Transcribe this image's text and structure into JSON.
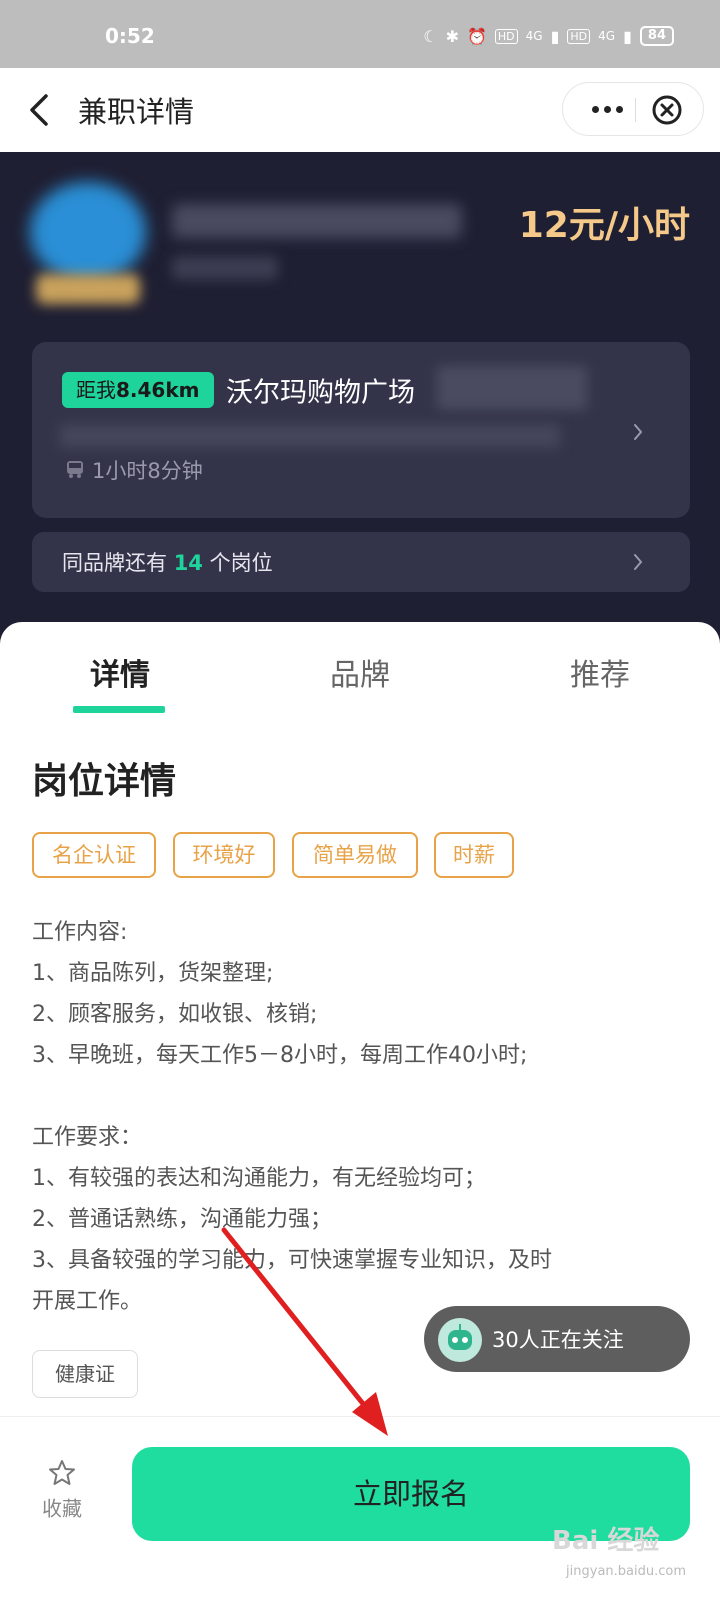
{
  "status_bar": {
    "time": "0:52",
    "battery": "84",
    "network_1": "4G",
    "network_2": "4G",
    "hd_1": "HD",
    "hd_2": "HD"
  },
  "nav": {
    "title": "兼职详情"
  },
  "job": {
    "salary": "12元/小时"
  },
  "location": {
    "distance_prefix": "距我",
    "distance_value": "8.46km",
    "place_name": "沃尔玛购物广场",
    "transit_time": "1小时8分钟"
  },
  "brand_bar": {
    "prefix": "同品牌还有 ",
    "count": "14",
    "suffix": " 个岗位"
  },
  "tabs": [
    {
      "label": "详情"
    },
    {
      "label": "品牌"
    },
    {
      "label": "推荐"
    }
  ],
  "details": {
    "title": "岗位详情",
    "tags": [
      "名企认证",
      "环境好",
      "简单易做",
      "时薪"
    ],
    "lines": [
      "工作内容:",
      "1、商品陈列，货架整理;",
      "2、顾客服务，如收银、核销;",
      "3、早晚班，每天工作5－8小时，每周工作40小时;",
      "工作要求：",
      "1、有较强的表达和沟通能力，有无经验均可；",
      "2、普通话熟练，沟通能力强；",
      "3、具备较强的学习能力，可快速掌握专业知识，及时",
      "开展工作。"
    ],
    "cert_tag": "健康证"
  },
  "follow": {
    "text": "30人正在关注"
  },
  "bottom": {
    "favorite_label": "收藏",
    "apply_label": "立即报名"
  },
  "watermark": {
    "logo": "Bai 经验",
    "url": "jingyan.baidu.com"
  },
  "colors": {
    "accent": "#1fd49a",
    "header_bg": "#1f1f33",
    "salary": "#f5c98a",
    "tag": "#e8a348"
  }
}
